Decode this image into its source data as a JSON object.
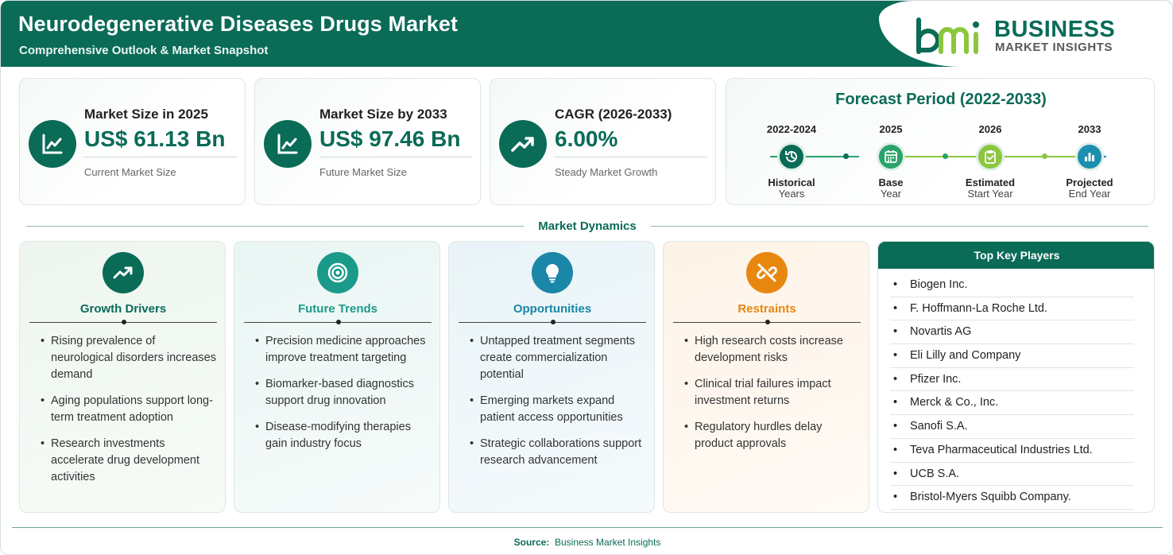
{
  "header": {
    "title": "Neurodegenerative Diseases Drugs Market",
    "subtitle": "Comprehensive Outlook & Market Snapshot",
    "logo_line1": "BUSINESS",
    "logo_line2": "MARKET INSIGHTS"
  },
  "metrics": [
    {
      "label": "Market Size in 2025",
      "value": "US$ 61.13 Bn",
      "note": "Current Market Size",
      "icon": "line-chart-icon"
    },
    {
      "label": "Market Size by 2033",
      "value": "US$ 97.46 Bn",
      "note": "Future Market Size",
      "icon": "line-chart-icon"
    },
    {
      "label": "CAGR (2026-2033)",
      "value": "6.00%",
      "note": "Steady Market Growth",
      "icon": "trending-up-icon"
    }
  ],
  "forecast": {
    "title": "Forecast Period (2022-2033)",
    "steps": [
      {
        "year": "2022-2024",
        "line1": "Historical",
        "line2": "Years",
        "icon": "history-icon",
        "color": "#0a6b57"
      },
      {
        "year": "2025",
        "line1": "Base",
        "line2": "Year",
        "icon": "calendar-icon",
        "color": "#2aa36b"
      },
      {
        "year": "2026",
        "line1": "Estimated",
        "line2": "Start Year",
        "icon": "clipboard-check-icon",
        "color": "#8cc63f"
      },
      {
        "year": "2033",
        "line1": "Projected",
        "line2": "End Year",
        "icon": "bar-chart-icon",
        "color": "#1c8fb0"
      }
    ]
  },
  "dynamics": {
    "title": "Market Dynamics",
    "panels": [
      {
        "title": "Growth Drivers",
        "color": "#0a6b57",
        "icon": "trending-up-icon",
        "items": [
          "Rising prevalence of neurological disorders increases demand",
          "Aging populations support long-term treatment adoption",
          "Research investments accelerate drug development activities"
        ]
      },
      {
        "title": "Future Trends",
        "color": "#1b9a8a",
        "icon": "target-icon",
        "items": [
          "Precision medicine approaches improve treatment targeting",
          "Biomarker-based diagnostics support drug innovation",
          "Disease-modifying therapies gain industry focus"
        ]
      },
      {
        "title": "Opportunities",
        "color": "#1a86a8",
        "icon": "lightbulb-icon",
        "items": [
          "Untapped treatment segments create commercialization potential",
          "Emerging markets expand patient access opportunities",
          "Strategic collaborations support research advancement"
        ]
      },
      {
        "title": "Restraints",
        "color": "#e8870f",
        "icon": "broken-link-icon",
        "items": [
          "High research costs increase development risks",
          "Clinical trial failures impact investment returns",
          "Regulatory hurdles delay product approvals"
        ]
      }
    ]
  },
  "players": {
    "title": "Top Key Players",
    "items": [
      "Biogen Inc.",
      "F. Hoffmann-La Roche Ltd.",
      "Novartis AG",
      "Eli Lilly and Company",
      "Pfizer Inc.",
      "Merck & Co., Inc.",
      "Sanofi S.A.",
      "Teva Pharmaceutical Industries Ltd.",
      "UCB S.A.",
      "Bristol-Myers Squibb Company."
    ]
  },
  "footer": {
    "source_label": "Source:",
    "source_value": "Business Market Insights"
  }
}
